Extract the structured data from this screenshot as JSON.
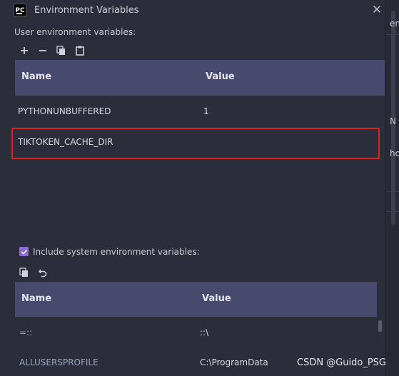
{
  "window": {
    "title": "Environment Variables",
    "close_glyph": "✕"
  },
  "background": {
    "frag_top": "en",
    "frag_mid": "N",
    "frag_low": "ho"
  },
  "user_section": {
    "label": "User environment variables:",
    "toolbar": [
      "add-icon",
      "remove-icon",
      "copy-icon",
      "paste-icon"
    ],
    "columns": {
      "name": "Name",
      "value": "Value"
    },
    "rows": [
      {
        "name": "PYTHONUNBUFFERED",
        "value": "1"
      },
      {
        "name": "TIKTOKEN_CACHE_DIR",
        "value": ""
      }
    ]
  },
  "system_section": {
    "checkbox_label": "Include system environment variables:",
    "checked": true,
    "toolbar": [
      "copy-icon",
      "revert-icon"
    ],
    "columns": {
      "name": "Name",
      "value": "Value"
    },
    "rows": [
      {
        "name": "=::",
        "value": "::\\"
      },
      {
        "name": "ALLUSERSPROFILE",
        "value": "C:\\ProgramData"
      }
    ]
  },
  "watermark": "CSDN @Guido_PSG",
  "colors": {
    "header_bg": "#484a6d",
    "dialog_bg": "#2b2d3a",
    "highlight": "#d3261e",
    "checkbox": "#8b6bd8"
  }
}
